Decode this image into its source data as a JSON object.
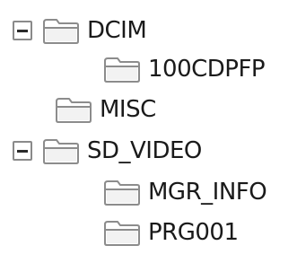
{
  "tree": {
    "nodes": [
      {
        "label": "DCIM",
        "icon": "folder-icon",
        "expanded": true,
        "has_children": true
      },
      {
        "label": "100CDPFP",
        "icon": "folder-icon",
        "has_children": false
      },
      {
        "label": "MISC",
        "icon": "folder-icon",
        "has_children": false
      },
      {
        "label": "SD_VIDEO",
        "icon": "folder-icon",
        "expanded": true,
        "has_children": true
      },
      {
        "label": "MGR_INFO",
        "icon": "folder-icon",
        "has_children": false
      },
      {
        "label": "PRG001",
        "icon": "folder-icon",
        "has_children": false
      }
    ]
  },
  "colors": {
    "folder_fill": "#ffffff",
    "folder_outline": "#8c8c8c",
    "expander_border": "#8a8a8a",
    "text": "#1a1a1a"
  }
}
